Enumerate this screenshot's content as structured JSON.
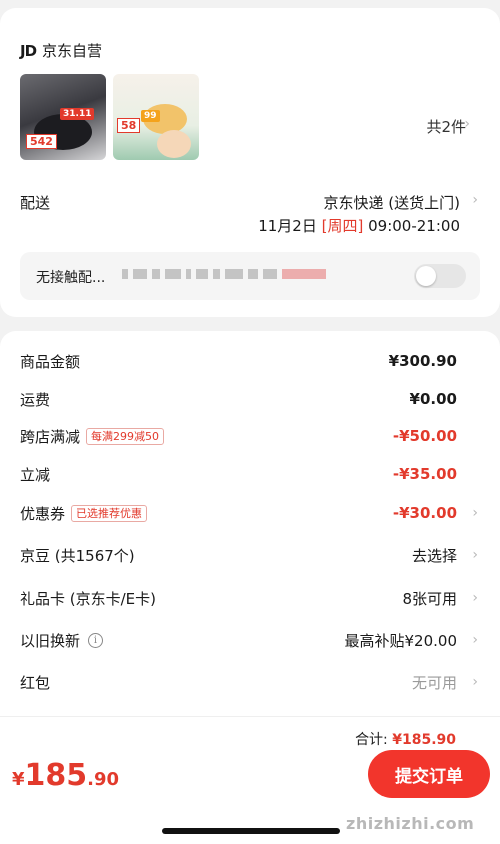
{
  "shop": {
    "logo": "JD",
    "name": "京东自营"
  },
  "products": {
    "thumb1": {
      "tag1": "31.11",
      "tag2": "542"
    },
    "thumb2": {
      "tag1": "58",
      "tag2": "99"
    }
  },
  "item_count_label": "共2件",
  "delivery": {
    "label": "配送",
    "method": "京东快递 (送货上门)",
    "date": "11月2日",
    "weekday": "[周四]",
    "time_range": "09:00-21:00"
  },
  "contactless": {
    "label": "无接触配...",
    "enabled": false
  },
  "summary": {
    "goods_amount": {
      "label": "商品金额",
      "value": "¥300.90"
    },
    "shipping": {
      "label": "运费",
      "value": "¥0.00"
    },
    "cross_store": {
      "label": "跨店满减",
      "badge": "每满299减50",
      "value": "-¥50.00"
    },
    "instant_discount": {
      "label": "立减",
      "value": "-¥35.00"
    },
    "coupon": {
      "label": "优惠券",
      "badge": "已选推荐优惠",
      "value": "-¥30.00"
    },
    "jingdou": {
      "label": "京豆 (共1567个)",
      "value": "去选择"
    },
    "gift_card": {
      "label": "礼品卡 (京东卡/E卡)",
      "value": "8张可用"
    },
    "trade_in": {
      "label": "以旧换新",
      "value": "最高补贴¥20.00"
    },
    "red_packet": {
      "label": "红包",
      "value": "无可用"
    }
  },
  "total": {
    "label": "合计:",
    "amount": "¥185.90"
  },
  "pay_price": {
    "currency": "¥",
    "integer": "185",
    "decimal": ".90"
  },
  "submit_label": "提交订单",
  "watermark": "zhizhizhi.com",
  "colors": {
    "accent": "#e23a2c",
    "button": "#f2352c"
  }
}
